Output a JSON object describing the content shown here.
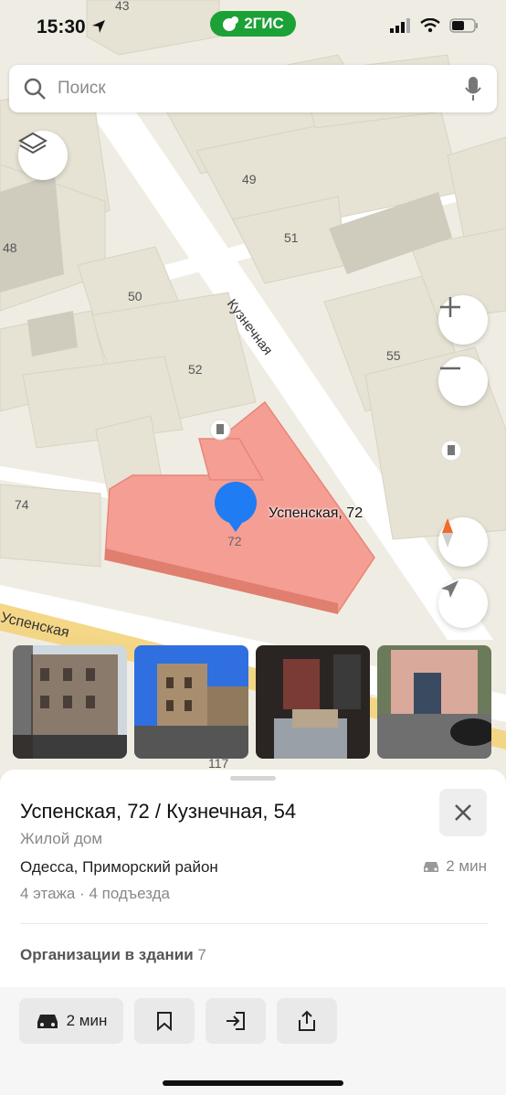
{
  "status_bar": {
    "time": "15:30",
    "logo_text": "2ГИС"
  },
  "search": {
    "placeholder": "Поиск"
  },
  "map": {
    "street_labels": [
      "Кузнечная",
      "Успенская"
    ],
    "house_numbers": [
      "43",
      "49",
      "51",
      "48",
      "50",
      "52",
      "55",
      "74",
      "117"
    ],
    "marker_number": "72",
    "marker_label": "Успенская, 72"
  },
  "icons": {
    "layers": "layers-icon",
    "zoom_in": "plus-icon",
    "zoom_out": "minus-icon",
    "compass": "compass-icon",
    "location": "navigation-arrow-icon",
    "search": "search-icon",
    "mic": "microphone-icon"
  },
  "colors": {
    "accent_green": "#1ba136",
    "building_highlight": "#f59e94",
    "marker": "#1f7cf2"
  },
  "place": {
    "title": "Успенская, 72 / Кузнечная, 54",
    "type": "Жилой дом",
    "address": "Одесса, Приморский район",
    "drive_time": "2 мин",
    "details": "4 этажа · 4 подъезда",
    "orgs_label": "Организации в здании",
    "orgs_count": "7"
  },
  "actions": {
    "route_label": "2 мин"
  }
}
